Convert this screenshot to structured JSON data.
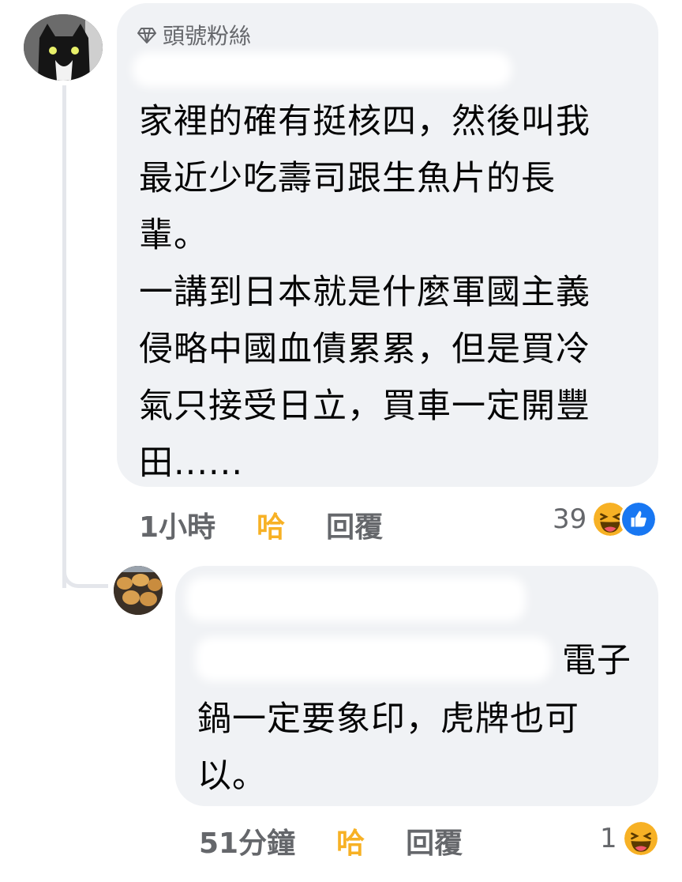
{
  "comment1": {
    "badge_icon": "diamond-icon",
    "badge_label": "頭號粉絲",
    "text_lines": [
      "家裡的確有挺核四，然後叫我",
      "最近少吃壽司跟生魚片的長",
      "輩。",
      "一講到日本就是什麼軍國主義",
      "侵略中國血債累累，但是買冷",
      "氣只接受日立，買車一定開豐",
      "田......"
    ],
    "time": "1小時",
    "reaction_label": "哈",
    "reply_label": "回覆",
    "reaction_count": "39",
    "reaction_icons": [
      "haha-emoji-icon",
      "like-thumb-icon"
    ]
  },
  "comment2": {
    "text_tail": "電子",
    "text_lines": [
      "鍋一定要象印，虎牌也可",
      "以。"
    ],
    "time": "51分鐘",
    "reaction_label": "哈",
    "reply_label": "回覆",
    "reaction_count": "1",
    "reaction_icons": [
      "haha-emoji-icon"
    ]
  },
  "colors": {
    "bubble": "#f0f2f5",
    "meta_text": "#65676b",
    "haha_reaction": "#f7b125",
    "like_blue": "#1877f2"
  }
}
